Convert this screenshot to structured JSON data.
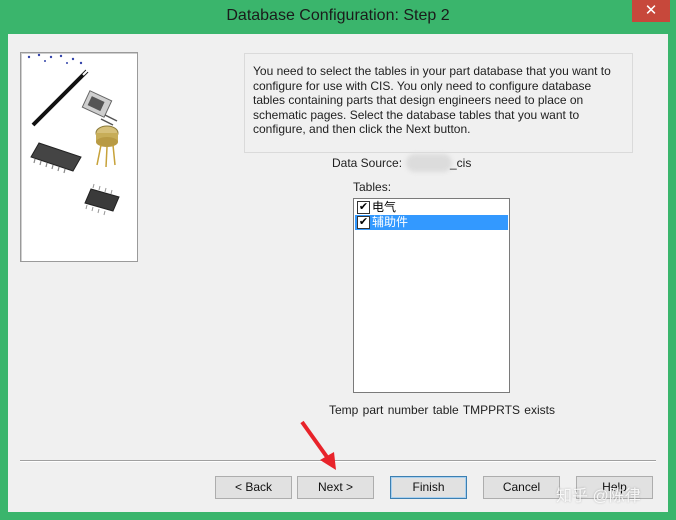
{
  "window": {
    "title": "Database Configuration: Step 2",
    "close_glyph": "✕"
  },
  "description": "You need to select the tables in your part database that you want to configure for use with CIS. You only need to configure database tables containing parts that design engineers need to place on schematic pages. Select the database tables that you want to configure, and then click the Next button.",
  "data_source": {
    "label": "Data Source:",
    "value": "_cis"
  },
  "tables": {
    "label": "Tables:",
    "items": [
      {
        "label": "电气",
        "checked": true,
        "selected": false
      },
      {
        "label": "辅助件",
        "checked": true,
        "selected": true
      }
    ]
  },
  "temp_table_text": "Temp part number table  TMPPRTS  exists",
  "buttons": {
    "back": "< Back",
    "next": "Next >",
    "finish": "Finish",
    "cancel": "Cancel",
    "help": "Help"
  },
  "watermark": "知乎 @陈律",
  "colors": {
    "frame": "#3ab56c",
    "close": "#c7483b",
    "selection": "#3399ff",
    "arrow": "#e8232a"
  },
  "icons": [
    "close-icon",
    "checkbox-checked-icon",
    "pointer-arrow-icon"
  ]
}
